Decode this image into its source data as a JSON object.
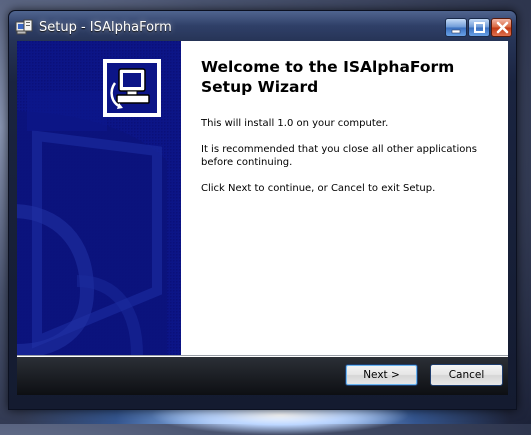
{
  "window": {
    "title": "Setup - ISAlphaForm"
  },
  "wizard": {
    "heading": "Welcome to the ISAlphaForm Setup Wizard",
    "install_text": "This will install 1.0 on your computer.",
    "recommend_text": "It is recommended that you close all other applications before continuing.",
    "instruction_text": "Click Next to continue, or Cancel to exit Setup."
  },
  "buttons": {
    "next_label": "Next >",
    "cancel_label": "Cancel"
  },
  "icons": {
    "app": "setup-app-icon",
    "minimize": "minimize-icon",
    "maximize": "maximize-icon",
    "close": "close-icon",
    "logo": "computer-install-icon"
  },
  "colors": {
    "side_panel": "#0c1587",
    "close_button": "#c23a14",
    "focus_outline": "#6bb6f0"
  }
}
